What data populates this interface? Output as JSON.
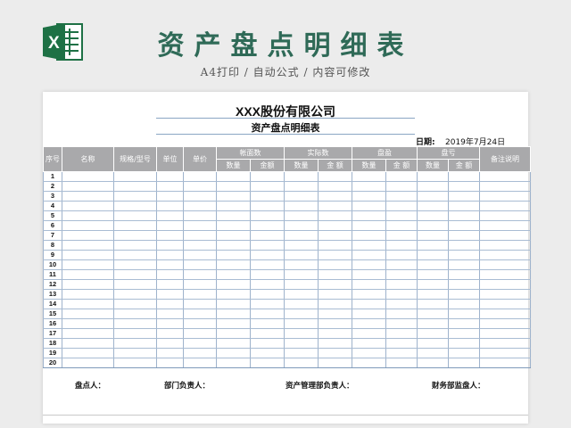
{
  "header": {
    "title": "资产盘点明细表",
    "subtitle": "A4打印 / 自动公式 / 内容可修改",
    "logo_icon": "excel-icon",
    "accent": "#2f6a57",
    "excel_green": "#1e7145"
  },
  "sheet": {
    "company": "XXX股份有限公司",
    "form_name": "资产盘点明细表",
    "date_label": "日期:",
    "date_value": "2019年7月24日",
    "columns": {
      "seq": "序号",
      "name": "名称",
      "spec": "规格/型号",
      "unit": "单位",
      "price": "单价",
      "book": "帐面数",
      "actual": "实际数",
      "surplus": "盘盈",
      "loss": "盘亏",
      "remark": "备注说明",
      "qty": "数量",
      "amount1": "金额",
      "amount2": "金 额"
    },
    "rows": [
      "1",
      "2",
      "3",
      "4",
      "5",
      "6",
      "7",
      "8",
      "9",
      "10",
      "11",
      "12",
      "13",
      "14",
      "15",
      "16",
      "17",
      "18",
      "19",
      "20"
    ],
    "signatures": {
      "counter": "盘点人：",
      "dept_head": "部门负责人：",
      "asset_head": "资产管理部负责人：",
      "finance": "财务部监盘人："
    },
    "header_bg": "#a9a9ab",
    "grid_line": "#9fb3cc"
  }
}
